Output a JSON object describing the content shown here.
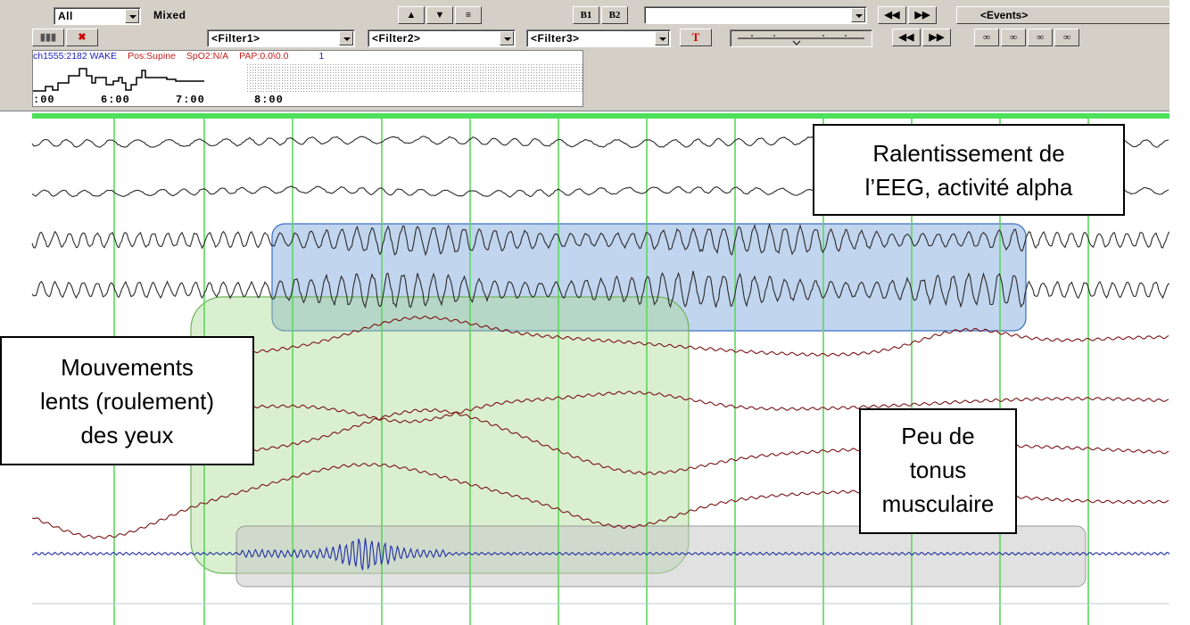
{
  "toolbar": {
    "channel_select": "All",
    "montage_label": "Mixed",
    "b1_label": "B1",
    "b2_label": "B2",
    "events_label": "<Events>",
    "filters": [
      "<Filter1>",
      "<Filter2>",
      "<Filter3>"
    ],
    "t_button_label": "T",
    "icon_names": [
      "zoom-in-icon",
      "zoom-out-icon",
      "channel-icon",
      "rewind-icon",
      "forward-icon",
      "prev-icon",
      "next-icon",
      "search-icon",
      "search-back-icon",
      "search-fwd-icon",
      "search-all-icon",
      "grid-icon",
      "close-icon"
    ]
  },
  "mini_panel": {
    "epoch": "ch1555:2182 WAKE",
    "position": "Pos:Supine",
    "spo2": "SpO2:N/A",
    "pap": "PAP:0.0\\0.0",
    "count": "1",
    "times": [
      ":00",
      "6:00",
      "7:00",
      "8:00"
    ]
  },
  "colors": {
    "eeg": "#2a2a2a",
    "eog": "#7a1414",
    "emg": "#1e2fa0",
    "gridline": "#5ed65e",
    "alpha_box": "#6b9bd8",
    "eye_box": "#a7d88f",
    "tone_box": "#c8c8c8"
  },
  "annotations": {
    "alpha": "Ralentissement de l’EEG, activité alpha",
    "alpha_lines": [
      "Ralentissement de",
      "l’EEG, activité alpha"
    ],
    "eye_lines": [
      "Mouvements",
      "lents (roulement)",
      "des yeux"
    ],
    "tone_lines": [
      "Peu de",
      "tonus",
      "musculaire"
    ]
  }
}
